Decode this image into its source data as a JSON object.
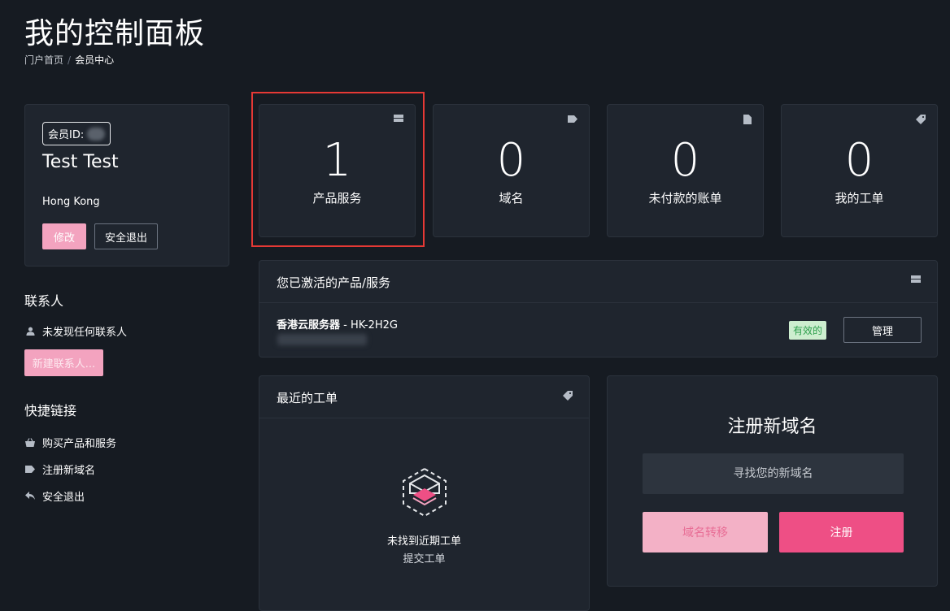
{
  "header": {
    "title": "我的控制面板",
    "breadcrumb": {
      "home": "门户首页",
      "separator": "/",
      "current": "会员中心"
    }
  },
  "profile": {
    "member_id_label": "会员ID:",
    "name": "Test Test",
    "city": "Hong Kong",
    "edit_label": "修改",
    "logout_label": "安全退出"
  },
  "contacts": {
    "heading": "联系人",
    "empty_text": "未发现任何联系人",
    "new_button": "新建联系人..."
  },
  "quick_links": {
    "heading": "快捷链接",
    "items": [
      {
        "label": "购买产品和服务",
        "icon": "basket-icon"
      },
      {
        "label": "注册新域名",
        "icon": "tag-icon"
      },
      {
        "label": "安全退出",
        "icon": "reply-icon"
      }
    ]
  },
  "stats": [
    {
      "value": "1",
      "label": "产品服务",
      "icon": "server-icon"
    },
    {
      "value": "0",
      "label": "域名",
      "icon": "tag-icon"
    },
    {
      "value": "0",
      "label": "未付款的账单",
      "icon": "document-icon"
    },
    {
      "value": "0",
      "label": "我的工单",
      "icon": "ticket-icon"
    }
  ],
  "active_products": {
    "title": "您已激活的产品/服务",
    "items": [
      {
        "name": "香港云服务器",
        "plan": " - HK-2H2G",
        "status": "有效的",
        "action": "管理"
      }
    ]
  },
  "recent_tickets": {
    "title": "最近的工单",
    "empty_text": "未找到近期工单",
    "submit_link": "提交工单"
  },
  "domain_register": {
    "title": "注册新域名",
    "placeholder": "寻找您的新域名",
    "transfer_label": "域名转移",
    "register_label": "注册"
  },
  "colors": {
    "background": "#161b22",
    "panel": "#1f252e",
    "accent_pink": "#ee4f85",
    "light_pink": "#f3a3bf",
    "status_green": "#2e9f4d",
    "highlight_red": "#e53935"
  }
}
